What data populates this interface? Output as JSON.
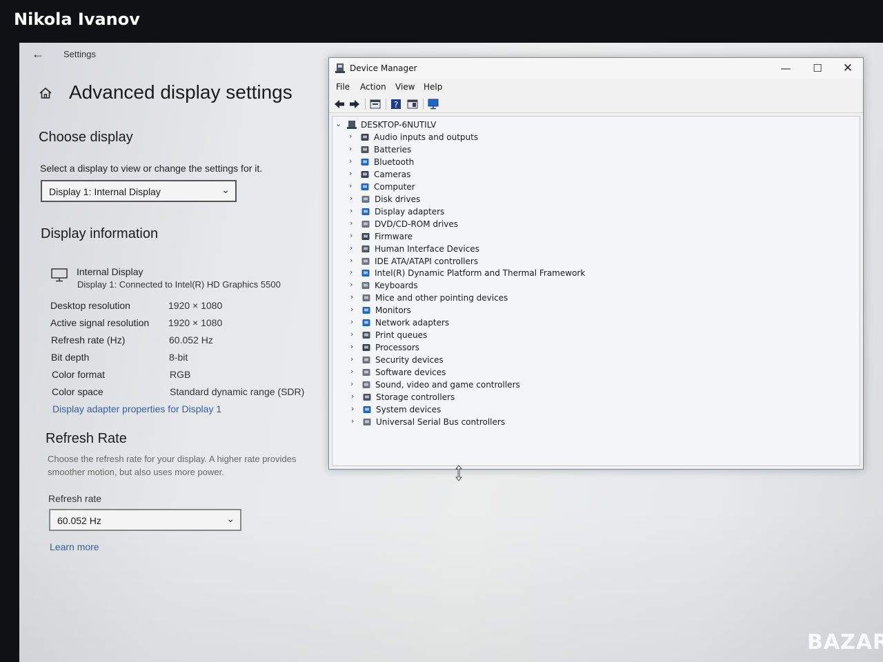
{
  "photo_credit": "Nikola Ivanov",
  "settings": {
    "back_icon": "back-arrow-icon",
    "app_label": "Settings",
    "page_title": "Advanced display settings",
    "choose_display": {
      "title": "Choose display",
      "description": "Select a display to view or change the settings for it.",
      "selected": "Display 1: Internal Display"
    },
    "display_info": {
      "title": "Display information",
      "monitor_name": "Internal Display",
      "monitor_sub": "Display 1: Connected to Intel(R) HD Graphics 5500",
      "rows": [
        {
          "label": "Desktop resolution",
          "value": "1920 × 1080"
        },
        {
          "label": "Active signal resolution",
          "value": "1920 × 1080"
        },
        {
          "label": "Refresh rate (Hz)",
          "value": "60.052 Hz"
        },
        {
          "label": "Bit depth",
          "value": "8-bit"
        },
        {
          "label": "Color format",
          "value": "RGB"
        },
        {
          "label": "Color space",
          "value": "Standard dynamic range (SDR)"
        }
      ],
      "adapter_link": "Display adapter properties for Display 1"
    },
    "refresh_rate": {
      "title": "Refresh Rate",
      "description": "Choose the refresh rate for your display. A higher rate provides smoother motion, but also uses more power.",
      "label": "Refresh rate",
      "selected": "60.052 Hz",
      "learn_more": "Learn more"
    }
  },
  "device_manager": {
    "title": "Device Manager",
    "window_buttons": {
      "minimize": "—",
      "maximize": "☐",
      "close": "✕"
    },
    "menu": [
      "File",
      "Action",
      "View",
      "Help"
    ],
    "toolbar_icons": [
      "back-arrow-icon",
      "forward-arrow-icon",
      "properties-icon",
      "help-icon",
      "panel-icon",
      "monitor-scan-icon"
    ],
    "root": "DESKTOP-6NUTILV",
    "categories": [
      "Audio inputs and outputs",
      "Batteries",
      "Bluetooth",
      "Cameras",
      "Computer",
      "Disk drives",
      "Display adapters",
      "DVD/CD-ROM drives",
      "Firmware",
      "Human Interface Devices",
      "IDE ATA/ATAPI controllers",
      "Intel(R) Dynamic Platform and Thermal Framework",
      "Keyboards",
      "Mice and other pointing devices",
      "Monitors",
      "Network adapters",
      "Print queues",
      "Processors",
      "Security devices",
      "Software devices",
      "Sound, video and game controllers",
      "Storage controllers",
      "System devices",
      "Universal Serial Bus controllers"
    ]
  },
  "watermark": "BAZAR",
  "colors": {
    "link": "#2f5fa8",
    "accent": "#1f66c4"
  }
}
